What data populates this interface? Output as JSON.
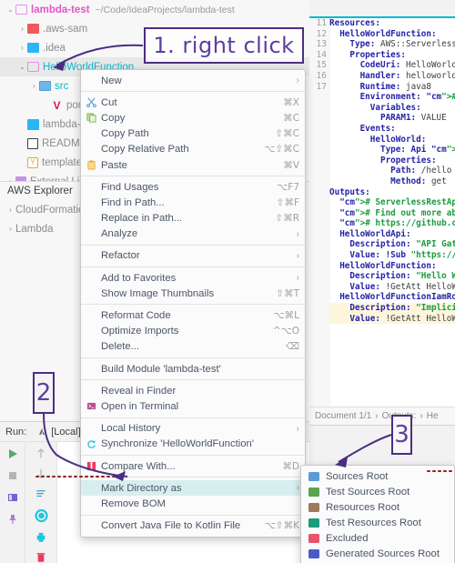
{
  "project_tree": {
    "items": [
      {
        "indent": 0,
        "arrow": "v",
        "icon": "folder-outline-icon",
        "label": "lambda-test",
        "style": "bold-pink",
        "note": "~/Code/IdeaProjects/lambda-test"
      },
      {
        "indent": 1,
        "arrow": ">",
        "icon": "folder-red-icon",
        "label": ".aws-sam",
        "style": "gray",
        "note": ""
      },
      {
        "indent": 1,
        "arrow": ">",
        "icon": "folder-idea-icon",
        "label": ".idea",
        "style": "gray",
        "note": ""
      },
      {
        "indent": 1,
        "arrow": "v",
        "icon": "folder-outline-icon",
        "label": "HelloWorldFunction",
        "style": "cyan",
        "note": "",
        "selected": true
      },
      {
        "indent": 2,
        "arrow": ">",
        "icon": "folder-blue-icon",
        "label": "src",
        "style": "cyan",
        "note": ""
      },
      {
        "indent": 3,
        "arrow": "",
        "icon": "maven-icon",
        "label": "pom.xml",
        "style": "gray",
        "note": ""
      },
      {
        "indent": 1,
        "arrow": "",
        "icon": "iml-icon",
        "label": "lambda-test.iml",
        "style": "gray",
        "note": ""
      },
      {
        "indent": 1,
        "arrow": "",
        "icon": "readme-icon",
        "label": "README.md",
        "style": "gray",
        "note": ""
      },
      {
        "indent": 1,
        "arrow": "",
        "icon": "yaml-icon",
        "label": "template.yaml",
        "style": "gray",
        "note": ""
      },
      {
        "indent": 0,
        "arrow": ">",
        "icon": "library-icon",
        "label": "External Libraries",
        "style": "gray",
        "note": ""
      }
    ]
  },
  "aws_explorer": {
    "title": "AWS Explorer",
    "items": [
      {
        "arrow": ">",
        "label": "CloudFormation"
      },
      {
        "arrow": ">",
        "label": "Lambda"
      }
    ]
  },
  "run_panel": {
    "label": "Run:",
    "config_name": "[Local]",
    "toolbar_icons": [
      "run-icon",
      "stop-icon",
      "layout-icon",
      "pin-icon"
    ],
    "toolbar2_icons": [
      "up-arrow-icon",
      "down-arrow-icon",
      "soft-wrap-icon",
      "scroll-to-end-icon",
      "print-icon",
      "trash-icon"
    ]
  },
  "editor": {
    "gutter_lines": [
      "11",
      "12",
      "13",
      "14",
      "15",
      "16",
      "17"
    ],
    "breadcrumb": [
      "Document 1/1",
      "Outputs:",
      "He"
    ],
    "code_lines": [
      "Resources:",
      "  HelloWorldFunction:",
      "    Type: AWS::Serverless::F",
      "    Properties:",
      "      CodeUri: HelloWorldFun",
      "      Handler: helloworld.Ap",
      "      Runtime: java8",
      "      Environment: # More in",
      "        Variables:",
      "          PARAM1: VALUE",
      "      Events:",
      "        HelloWorld:",
      "          Type: Api # More :",
      "          Properties:",
      "            Path: /hello",
      "            Method: get",
      "",
      "Outputs:",
      "  # ServerlessRestApi is an",
      "  # Find out more about othe",
      "  # https://github.com/awsla",
      "  HelloWorldApi:",
      "    Description: \"API Gatewa",
      "    Value: !Sub \"https://${S",
      "  HelloWorldFunction:",
      "    Description: \"Hello Worl",
      "    Value: !GetAtt HelloWorl",
      "  HelloWorldFunctionIamRole:",
      "    Description: \"Implicit I",
      "    Value: !GetAtt HelloWorl"
    ]
  },
  "context_menu": {
    "groups": [
      [
        {
          "label": "New",
          "icon": "",
          "accel": "",
          "arrow": ">"
        }
      ],
      [
        {
          "label": "Cut",
          "icon": "scissors-icon",
          "accel": "⌘X",
          "arrow": ""
        },
        {
          "label": "Copy",
          "icon": "copy-icon",
          "accel": "⌘C",
          "arrow": ""
        },
        {
          "label": "Copy Path",
          "icon": "",
          "accel": "⇧⌘C",
          "arrow": ""
        },
        {
          "label": "Copy Relative Path",
          "icon": "",
          "accel": "⌥⇧⌘C",
          "arrow": ""
        },
        {
          "label": "Paste",
          "icon": "clipboard-icon",
          "accel": "⌘V",
          "arrow": ""
        }
      ],
      [
        {
          "label": "Find Usages",
          "icon": "",
          "accel": "⌥F7",
          "arrow": ""
        },
        {
          "label": "Find in Path...",
          "icon": "",
          "accel": "⇧⌘F",
          "arrow": ""
        },
        {
          "label": "Replace in Path...",
          "icon": "",
          "accel": "⇧⌘R",
          "arrow": ""
        },
        {
          "label": "Analyze",
          "icon": "",
          "accel": "",
          "arrow": ">"
        }
      ],
      [
        {
          "label": "Refactor",
          "icon": "",
          "accel": "",
          "arrow": ">"
        }
      ],
      [
        {
          "label": "Add to Favorites",
          "icon": "",
          "accel": "",
          "arrow": ">"
        },
        {
          "label": "Show Image Thumbnails",
          "icon": "",
          "accel": "⇧⌘T",
          "arrow": ""
        }
      ],
      [
        {
          "label": "Reformat Code",
          "icon": "",
          "accel": "⌥⌘L",
          "arrow": ""
        },
        {
          "label": "Optimize Imports",
          "icon": "",
          "accel": "^⌥O",
          "arrow": ""
        },
        {
          "label": "Delete...",
          "icon": "",
          "accel": "⌫",
          "arrow": ""
        }
      ],
      [
        {
          "label": "Build Module 'lambda-test'",
          "icon": "",
          "accel": "",
          "arrow": ""
        }
      ],
      [
        {
          "label": "Reveal in Finder",
          "icon": "",
          "accel": "",
          "arrow": ""
        },
        {
          "label": "Open in Terminal",
          "icon": "terminal-icon",
          "accel": "",
          "arrow": ""
        }
      ],
      [
        {
          "label": "Local History",
          "icon": "",
          "accel": "",
          "arrow": ">"
        },
        {
          "label": "Synchronize 'HelloWorldFunction'",
          "icon": "sync-icon",
          "accel": "",
          "arrow": ""
        }
      ],
      [
        {
          "label": "Compare With...",
          "icon": "compare-icon",
          "accel": "⌘D",
          "arrow": ""
        }
      ],
      [
        {
          "label": "Mark Directory as",
          "icon": "",
          "accel": "",
          "arrow": ">",
          "highlighted": true
        },
        {
          "label": "Remove BOM",
          "icon": "",
          "accel": "",
          "arrow": ""
        }
      ],
      [
        {
          "label": "Convert Java File to Kotlin File",
          "icon": "",
          "accel": "⌥⇧⌘K",
          "arrow": ""
        }
      ]
    ]
  },
  "submenu": {
    "items": [
      {
        "label": "Sources Root",
        "color": "#5a9bd8"
      },
      {
        "label": "Test Sources Root",
        "color": "#5aa34f"
      },
      {
        "label": "Resources Root",
        "color": "#9b7b5a"
      },
      {
        "label": "Test Resources Root",
        "color": "#1a9b7b"
      },
      {
        "label": "Excluded",
        "color": "#e8536e"
      },
      {
        "label": "Generated Sources Root",
        "color": "#4a5bc8"
      }
    ]
  },
  "annotations": {
    "step1": "1. right click",
    "step2": "2",
    "step3": "3",
    "ink_color": "#4b2e83",
    "dotted_color": "#8b2020"
  }
}
